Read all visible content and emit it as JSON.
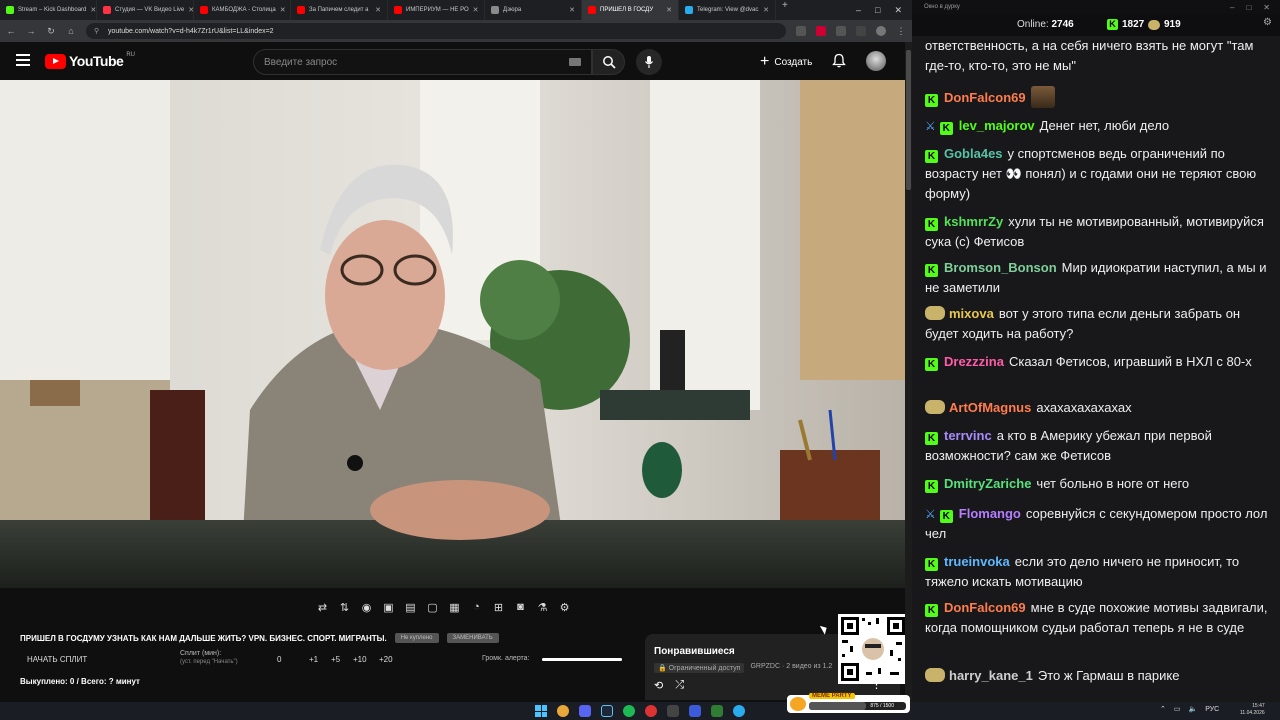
{
  "browser": {
    "tabs": [
      {
        "label": "Stream – Kick Dashboard",
        "color": "#53fc18",
        "active": false
      },
      {
        "label": "Студия — VK Видео Live",
        "color": "#ff3344",
        "active": false
      },
      {
        "label": "КАМБОДЖА - Столица",
        "color": "#ff0000",
        "active": false
      },
      {
        "label": "За Папичем следит а",
        "color": "#ff0000",
        "active": false
      },
      {
        "label": "ИМПЕРИУМ — НЕ РО",
        "color": "#ff0000",
        "active": false
      },
      {
        "label": "Дзюра",
        "color": "#8a8a8a",
        "active": false
      },
      {
        "label": "ПРИШЕЛ В ГОСДУ",
        "color": "#ff0000",
        "active": true
      },
      {
        "label": "Telegram: View @dvac",
        "color": "#2aabee",
        "active": false
      }
    ],
    "url": "youtube.com/watch?v=d-h4k7Zr1rU&list=LL&index=2"
  },
  "youtube": {
    "logo_text": "YouTube",
    "logo_region": "RU",
    "search_placeholder": "Введите запрос",
    "create_label": "Создать"
  },
  "video": {
    "title": "ПРИШЕЛ В ГОСДУМУ УЗНАТЬ КАК НАМ ДАЛЬШЕ ЖИТЬ? VPN. БИЗНЕС. СПОРТ. МИГРАНТЫ.",
    "button_1": "Не куплено",
    "button_2": "ЗАМЕНИВАТЬ"
  },
  "split": {
    "start_label": "НАЧАТЬ СПЛИТ",
    "minutes_label": "Сплит (мин):",
    "minutes_sub": "(уст. перед \"Начать\")",
    "value": "0",
    "steps": [
      "+1",
      "+5",
      "+10",
      "+20"
    ],
    "alert_label": "Громк. алерта:",
    "alert_volume": 1.0,
    "bought_label": "Выкуплено: 0 / Всего: ? минут"
  },
  "playlist": {
    "title": "Понравившиеся",
    "access": "Ограниченный доступ",
    "meta": "GRPZDC · 2 видео из 1.2"
  },
  "chat": {
    "window_title": "Окно в дурку",
    "online_label": "Online:",
    "online_count": "2746",
    "k_count": "1827",
    "c_count": "919",
    "messages": [
      {
        "user": "",
        "text": "ответственность, а на себя ничего взять не могут \"там где-то, кто-то, это не мы\"",
        "color": "#efeff1",
        "badge": false,
        "mod": false
      },
      {
        "user": "DonFalcon69",
        "text": "",
        "color": "#ff7d4d",
        "badge": true,
        "mod": false,
        "emote": true
      },
      {
        "user": "lev_majorov",
        "text": "Денег нет, люби дело",
        "color": "#53fc18",
        "badge": true,
        "mod": true
      },
      {
        "user": "Gobla4es",
        "text": "у спортсменов ведь ограничений по возрасту нет 👀 понял) и с годами они не теряют свою форму)",
        "color": "#58c1a6",
        "badge": true,
        "mod": false
      },
      {
        "user": "kshmrrZy",
        "text": "хули ты не мотивированный, мотивируйся сука (с) Фетисов",
        "color": "#55e05a",
        "badge": true,
        "mod": false
      },
      {
        "user": "Bromson_Bonson",
        "text": "Мир идиократии наступил, а мы и не заметили",
        "color": "#7fcf9a",
        "badge": true,
        "mod": false
      },
      {
        "user": "mixova",
        "text": "вот у этого типа если деньги забрать он будет ходить на работу?",
        "color": "#e9c84c",
        "badge": false,
        "mod": false
      },
      {
        "user": "Drezzzina",
        "text": "Сказал Фетисов, игравший в НХЛ с 80-х",
        "color": "#ff5ca8",
        "badge": true,
        "mod": false
      },
      {
        "user": "ArtOfMagnus",
        "text": "ахахахахахахах",
        "color": "#ff7d4d",
        "badge": false,
        "mod": false
      },
      {
        "user": "terrvinc",
        "text": "а кто в Америку убежал при первой возможности? сам же Фетисов",
        "color": "#a78bfa",
        "badge": true,
        "mod": false
      },
      {
        "user": "DmitryZariche",
        "text": "чет больно в ноге от него",
        "color": "#58e07a",
        "badge": true,
        "mod": false
      },
      {
        "user": "Flomango",
        "text": "соревнуйся с секундомером просто лол чел",
        "color": "#b57dff",
        "badge": true,
        "mod": true
      },
      {
        "user": "trueinvoka",
        "text": "если это дело ничего не приносит, то тяжело искать мотивацию",
        "color": "#5fb8ff",
        "badge": true,
        "mod": false
      },
      {
        "user": "DonFalcon69",
        "text": "мне в суде похожие мотивы задвигали, когда помощником судьи работал теперь я не в суде",
        "color": "#ff7d4d",
        "badge": true,
        "mod": false
      },
      {
        "user": "harry_kane_1",
        "text": "Это ж Гармаш в парике",
        "color": "#cfcfcf",
        "badge": false,
        "mod": false
      }
    ]
  },
  "overlay": {
    "meme_title": "MEME PARTY",
    "meme_progress": "875 / 1500",
    "meme_fraction": 0.583
  },
  "taskbar": {
    "lang": "РУС",
    "time": "15:47",
    "date": "11.04.2026"
  }
}
